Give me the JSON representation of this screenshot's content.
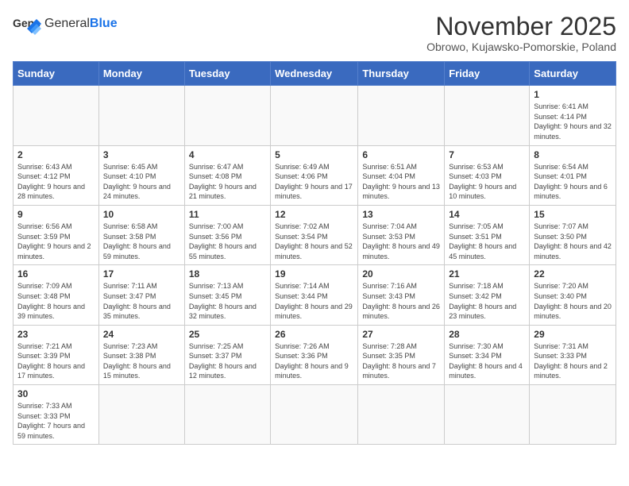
{
  "logo": {
    "text_general": "General",
    "text_blue": "Blue"
  },
  "title": "November 2025",
  "location": "Obrowo, Kujawsko-Pomorskie, Poland",
  "weekdays": [
    "Sunday",
    "Monday",
    "Tuesday",
    "Wednesday",
    "Thursday",
    "Friday",
    "Saturday"
  ],
  "weeks": [
    [
      {
        "day": "",
        "info": ""
      },
      {
        "day": "",
        "info": ""
      },
      {
        "day": "",
        "info": ""
      },
      {
        "day": "",
        "info": ""
      },
      {
        "day": "",
        "info": ""
      },
      {
        "day": "",
        "info": ""
      },
      {
        "day": "1",
        "info": "Sunrise: 6:41 AM\nSunset: 4:14 PM\nDaylight: 9 hours and 32 minutes."
      }
    ],
    [
      {
        "day": "2",
        "info": "Sunrise: 6:43 AM\nSunset: 4:12 PM\nDaylight: 9 hours and 28 minutes."
      },
      {
        "day": "3",
        "info": "Sunrise: 6:45 AM\nSunset: 4:10 PM\nDaylight: 9 hours and 24 minutes."
      },
      {
        "day": "4",
        "info": "Sunrise: 6:47 AM\nSunset: 4:08 PM\nDaylight: 9 hours and 21 minutes."
      },
      {
        "day": "5",
        "info": "Sunrise: 6:49 AM\nSunset: 4:06 PM\nDaylight: 9 hours and 17 minutes."
      },
      {
        "day": "6",
        "info": "Sunrise: 6:51 AM\nSunset: 4:04 PM\nDaylight: 9 hours and 13 minutes."
      },
      {
        "day": "7",
        "info": "Sunrise: 6:53 AM\nSunset: 4:03 PM\nDaylight: 9 hours and 10 minutes."
      },
      {
        "day": "8",
        "info": "Sunrise: 6:54 AM\nSunset: 4:01 PM\nDaylight: 9 hours and 6 minutes."
      }
    ],
    [
      {
        "day": "9",
        "info": "Sunrise: 6:56 AM\nSunset: 3:59 PM\nDaylight: 9 hours and 2 minutes."
      },
      {
        "day": "10",
        "info": "Sunrise: 6:58 AM\nSunset: 3:58 PM\nDaylight: 8 hours and 59 minutes."
      },
      {
        "day": "11",
        "info": "Sunrise: 7:00 AM\nSunset: 3:56 PM\nDaylight: 8 hours and 55 minutes."
      },
      {
        "day": "12",
        "info": "Sunrise: 7:02 AM\nSunset: 3:54 PM\nDaylight: 8 hours and 52 minutes."
      },
      {
        "day": "13",
        "info": "Sunrise: 7:04 AM\nSunset: 3:53 PM\nDaylight: 8 hours and 49 minutes."
      },
      {
        "day": "14",
        "info": "Sunrise: 7:05 AM\nSunset: 3:51 PM\nDaylight: 8 hours and 45 minutes."
      },
      {
        "day": "15",
        "info": "Sunrise: 7:07 AM\nSunset: 3:50 PM\nDaylight: 8 hours and 42 minutes."
      }
    ],
    [
      {
        "day": "16",
        "info": "Sunrise: 7:09 AM\nSunset: 3:48 PM\nDaylight: 8 hours and 39 minutes."
      },
      {
        "day": "17",
        "info": "Sunrise: 7:11 AM\nSunset: 3:47 PM\nDaylight: 8 hours and 35 minutes."
      },
      {
        "day": "18",
        "info": "Sunrise: 7:13 AM\nSunset: 3:45 PM\nDaylight: 8 hours and 32 minutes."
      },
      {
        "day": "19",
        "info": "Sunrise: 7:14 AM\nSunset: 3:44 PM\nDaylight: 8 hours and 29 minutes."
      },
      {
        "day": "20",
        "info": "Sunrise: 7:16 AM\nSunset: 3:43 PM\nDaylight: 8 hours and 26 minutes."
      },
      {
        "day": "21",
        "info": "Sunrise: 7:18 AM\nSunset: 3:42 PM\nDaylight: 8 hours and 23 minutes."
      },
      {
        "day": "22",
        "info": "Sunrise: 7:20 AM\nSunset: 3:40 PM\nDaylight: 8 hours and 20 minutes."
      }
    ],
    [
      {
        "day": "23",
        "info": "Sunrise: 7:21 AM\nSunset: 3:39 PM\nDaylight: 8 hours and 17 minutes."
      },
      {
        "day": "24",
        "info": "Sunrise: 7:23 AM\nSunset: 3:38 PM\nDaylight: 8 hours and 15 minutes."
      },
      {
        "day": "25",
        "info": "Sunrise: 7:25 AM\nSunset: 3:37 PM\nDaylight: 8 hours and 12 minutes."
      },
      {
        "day": "26",
        "info": "Sunrise: 7:26 AM\nSunset: 3:36 PM\nDaylight: 8 hours and 9 minutes."
      },
      {
        "day": "27",
        "info": "Sunrise: 7:28 AM\nSunset: 3:35 PM\nDaylight: 8 hours and 7 minutes."
      },
      {
        "day": "28",
        "info": "Sunrise: 7:30 AM\nSunset: 3:34 PM\nDaylight: 8 hours and 4 minutes."
      },
      {
        "day": "29",
        "info": "Sunrise: 7:31 AM\nSunset: 3:33 PM\nDaylight: 8 hours and 2 minutes."
      }
    ],
    [
      {
        "day": "30",
        "info": "Sunrise: 7:33 AM\nSunset: 3:33 PM\nDaylight: 7 hours and 59 minutes."
      },
      {
        "day": "",
        "info": ""
      },
      {
        "day": "",
        "info": ""
      },
      {
        "day": "",
        "info": ""
      },
      {
        "day": "",
        "info": ""
      },
      {
        "day": "",
        "info": ""
      },
      {
        "day": "",
        "info": ""
      }
    ]
  ]
}
